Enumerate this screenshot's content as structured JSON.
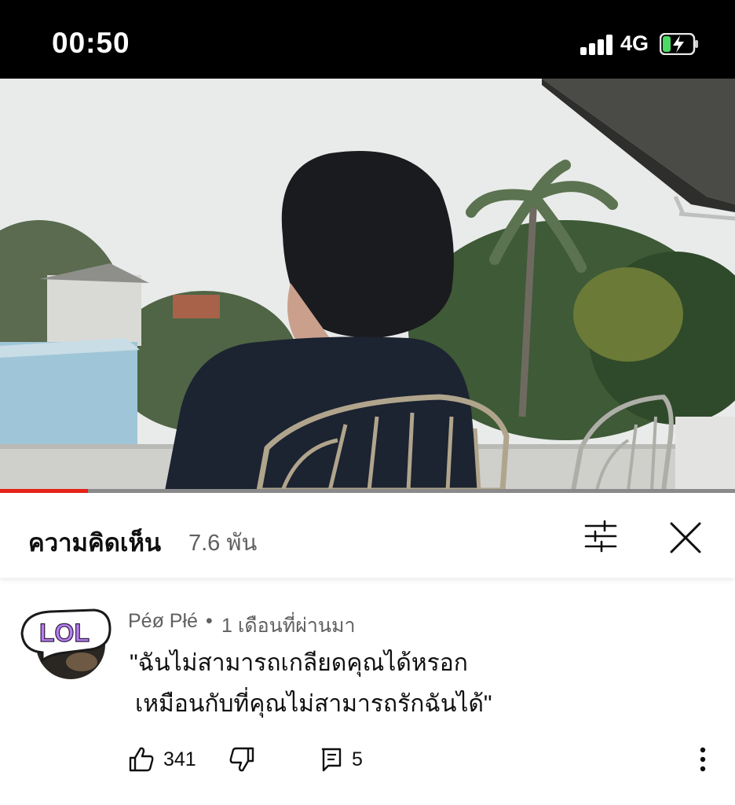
{
  "status_bar": {
    "time": "00:50",
    "network": "4G",
    "icons": [
      "signal-icon",
      "battery-charging-icon"
    ]
  },
  "video": {
    "description_icon": "video-frame",
    "progress_fraction": 0.12,
    "progress_color": "#e62117"
  },
  "comments_header": {
    "title": "ความคิดเห็น",
    "count": "7.6 พัน",
    "icons": [
      "filter-icon",
      "close-icon"
    ]
  },
  "comment": {
    "author": "Péø Płé",
    "separator": "•",
    "time": "1 เดือนที่ผ่านมา",
    "avatar_text": "LOL",
    "text_line1": "\"ฉันไม่สามารถเกลียดคุณได้หรอก",
    "text_line2": "เหมือนกับที่คุณไม่สามารถรักฉันได้\"",
    "likes": "341",
    "replies": "5",
    "icons": [
      "thumbs-up-icon",
      "thumbs-down-icon",
      "reply-icon",
      "more-vertical-icon"
    ]
  },
  "colors": {
    "text_primary": "#0f0f0f",
    "text_secondary": "#606060",
    "accent": "#e62117"
  }
}
